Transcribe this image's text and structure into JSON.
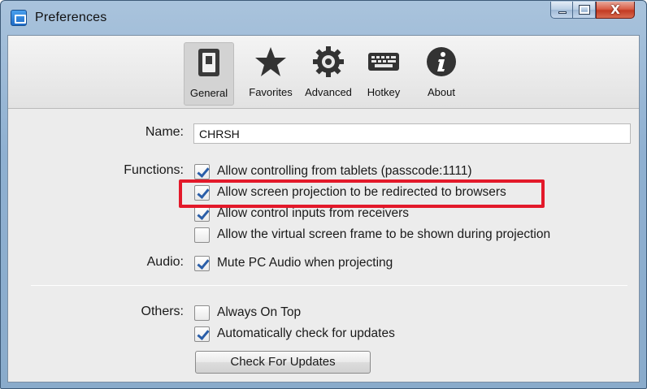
{
  "window": {
    "title": "Preferences",
    "close_glyph": "X"
  },
  "toolbar": {
    "tabs": [
      {
        "label": "General",
        "icon": "switch-icon",
        "active": true
      },
      {
        "label": "Favorites",
        "icon": "star-icon",
        "active": false
      },
      {
        "label": "Advanced",
        "icon": "gear-icon",
        "active": false
      },
      {
        "label": "Hotkey",
        "icon": "keyboard-icon",
        "active": false
      },
      {
        "label": "About",
        "icon": "info-icon",
        "active": false
      }
    ]
  },
  "general": {
    "name_label": "Name:",
    "name_value": "CHRSH",
    "functions_label": "Functions:",
    "functions": [
      {
        "label": "Allow controlling from tablets (passcode:1111)",
        "checked": true
      },
      {
        "label": "Allow screen projection to be redirected to browsers",
        "checked": true,
        "highlighted": true
      },
      {
        "label": "Allow control inputs from receivers",
        "checked": true
      },
      {
        "label": "Allow the virtual screen frame to be shown during projection",
        "checked": false
      }
    ],
    "audio_label": "Audio:",
    "audio": {
      "label": "Mute PC Audio when projecting",
      "checked": true
    },
    "others_label": "Others:",
    "others": [
      {
        "label": "Always On Top",
        "checked": false
      },
      {
        "label": "Automatically check for updates",
        "checked": true
      }
    ],
    "check_updates_button": "Check For Updates"
  },
  "colors": {
    "highlight": "#e3192a",
    "check": "#2a5ea8",
    "titlebar": "#8fb0d1"
  }
}
